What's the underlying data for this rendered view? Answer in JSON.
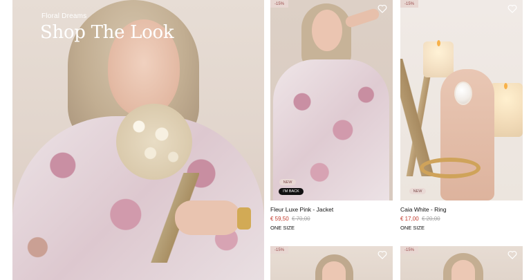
{
  "hero": {
    "subtitle": "Floral Dreams",
    "title": "Shop The Look"
  },
  "products": [
    {
      "discount": "-15%",
      "badge_new": "NEW",
      "badge_back": "I'M BACK",
      "name": "Fleur Luxe Pink - Jacket",
      "price_now": "€ 59,50",
      "price_was": "€ 70,00",
      "size": "ONE SIZE",
      "wishlist_icon": "heart-icon"
    },
    {
      "discount": "-15%",
      "badge_new": "NEW",
      "name": "Caia White - Ring",
      "price_now": "€ 17,00",
      "price_was": "€ 20,00",
      "size": "ONE SIZE",
      "wishlist_icon": "heart-icon"
    },
    {
      "discount": "-15%",
      "wishlist_icon": "heart-icon"
    },
    {
      "discount": "-15%",
      "wishlist_icon": "heart-icon"
    }
  ],
  "colors": {
    "sale_price": "#c0392b",
    "old_price": "#a7a7a7",
    "discount_badge_bg": "#e8d7d2",
    "discount_badge_text": "#9b4c4c",
    "back_badge_bg": "#111111"
  }
}
